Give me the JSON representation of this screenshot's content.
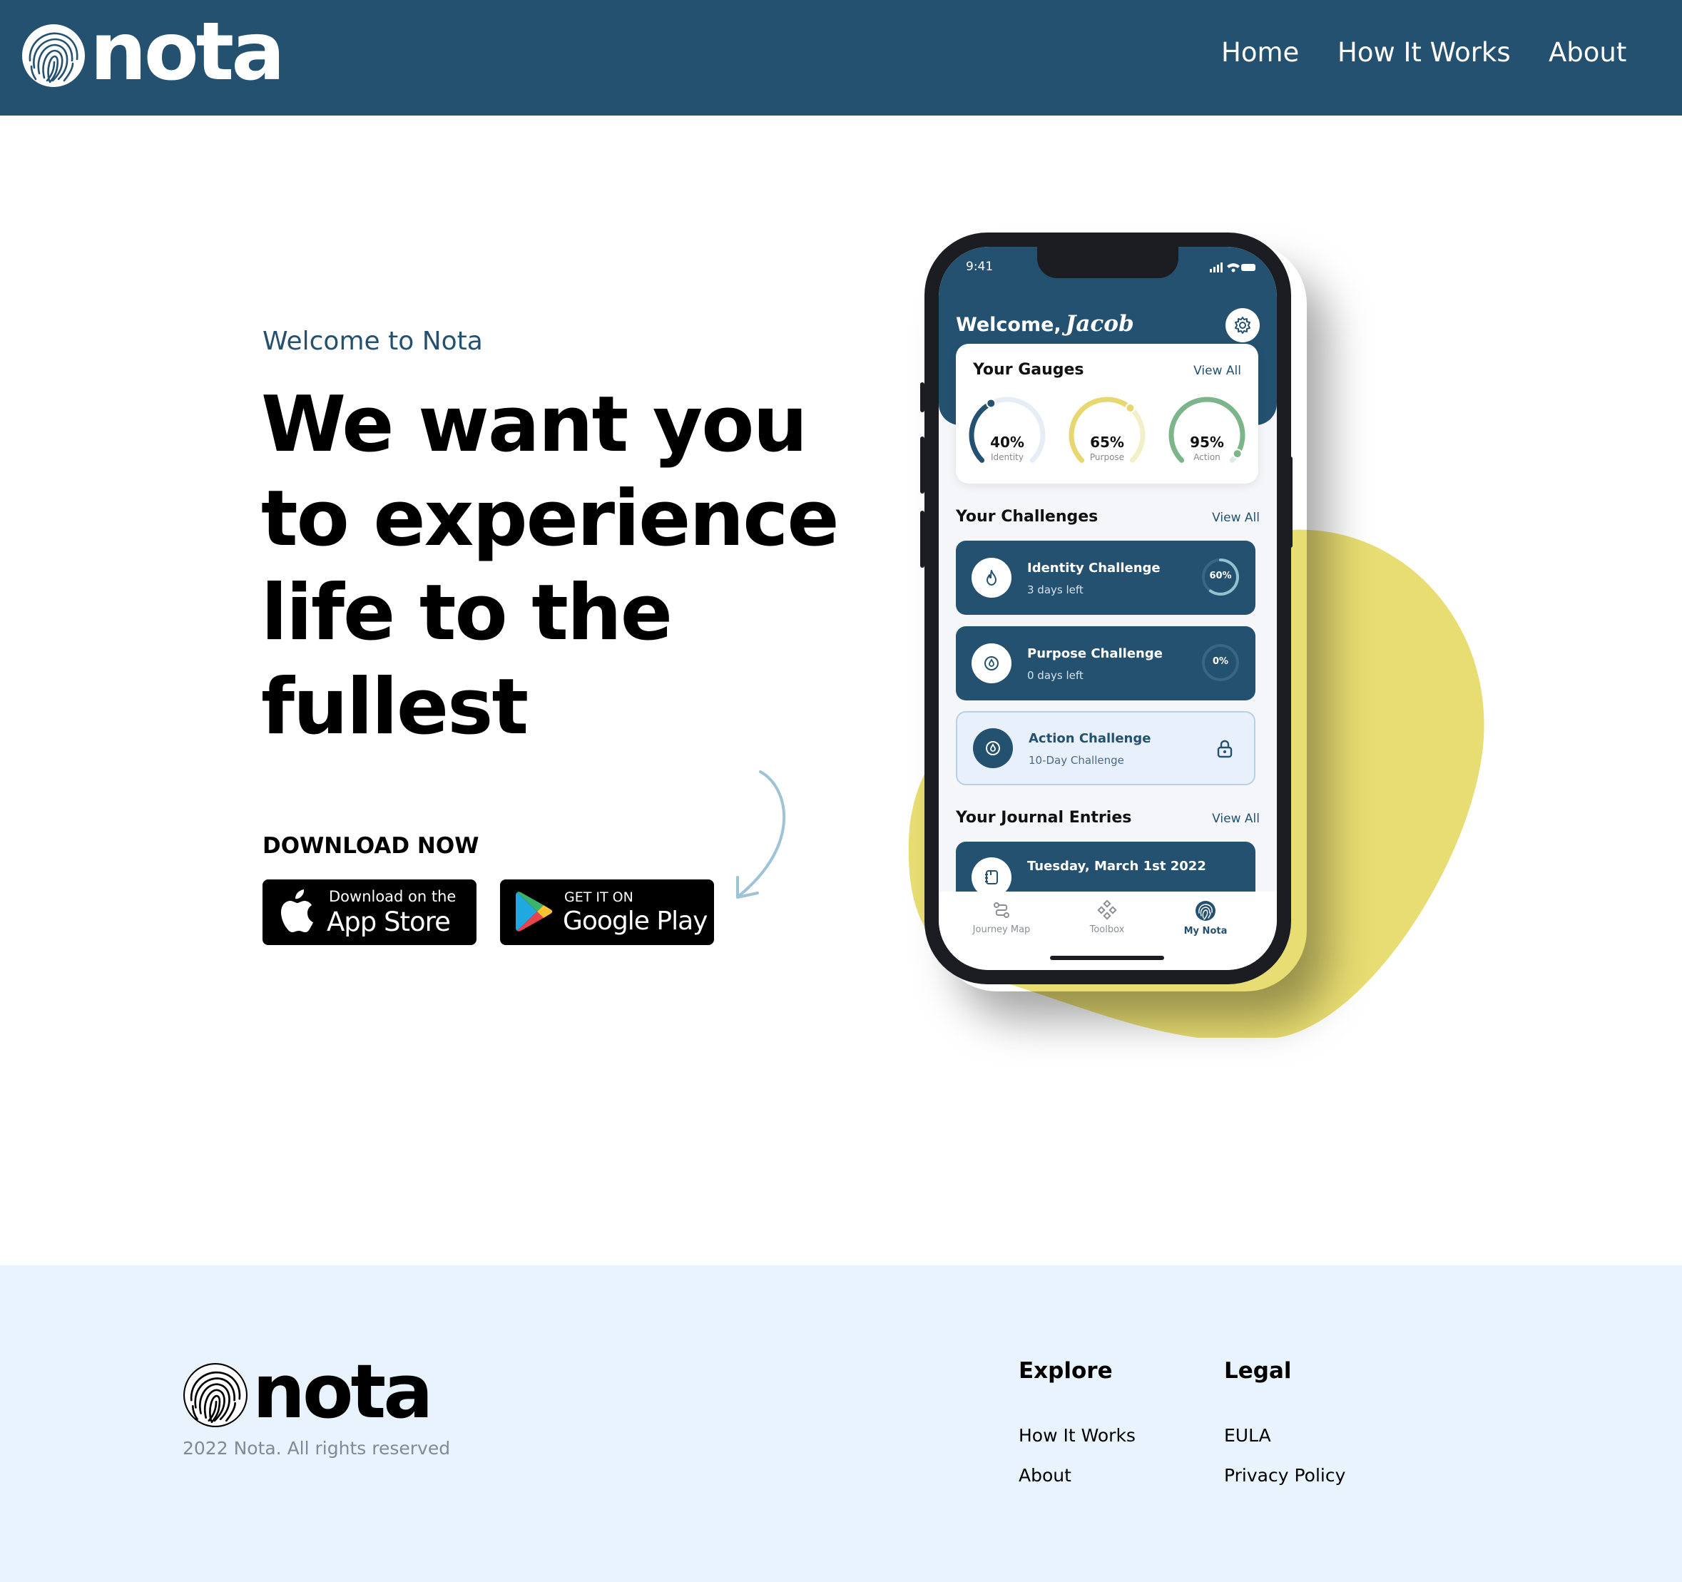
{
  "header": {
    "brand": "nota",
    "nav": [
      {
        "label": "Home"
      },
      {
        "label": "How It Works"
      },
      {
        "label": "About"
      }
    ]
  },
  "hero": {
    "eyebrow": "Welcome to Nota",
    "headline_lines": [
      "We want you",
      "to experience",
      "life to the",
      "fullest"
    ],
    "download_title": "DOWNLOAD NOW",
    "app_store": {
      "small": "Download on the",
      "big": "App Store"
    },
    "google_play": {
      "small": "GET IT ON",
      "big": "Google Play"
    }
  },
  "phone": {
    "status_time": "9:41",
    "welcome": "Welcome,",
    "user_name": "Jacob",
    "gauges": {
      "title": "Your Gauges",
      "view_all": "View All",
      "items": [
        {
          "value": "40%",
          "label": "Identity",
          "level": 0.4,
          "color": "#245170",
          "track": "#e6edf4"
        },
        {
          "value": "65%",
          "label": "Purpose",
          "level": 0.65,
          "color": "#e6d86f",
          "track": "#f3efc9"
        },
        {
          "value": "95%",
          "label": "Action",
          "level": 0.95,
          "color": "#7db58a",
          "track": "#dcebdf"
        }
      ]
    },
    "challenges": {
      "title": "Your Challenges",
      "view_all": "View All",
      "items": [
        {
          "name": "Identity Challenge",
          "sub": "3 days left",
          "progress": "60%",
          "level": 0.6
        },
        {
          "name": "Purpose Challenge",
          "sub": "0 days left",
          "progress": "0%",
          "level": 0
        },
        {
          "name": "Action Challenge",
          "sub": "10-Day Challenge",
          "locked": true
        }
      ]
    },
    "journal": {
      "title": "Your Journal Entries",
      "view_all": "View All",
      "entry": "Tuesday, March 1st 2022"
    },
    "tabs": [
      {
        "label": "Journey Map"
      },
      {
        "label": "Toolbox"
      },
      {
        "label": "My Nota"
      }
    ]
  },
  "footer": {
    "brand": "nota",
    "copyright": "2022 Nota. All rights reserved",
    "explore": {
      "title": "Explore",
      "links": [
        "How It Works",
        "About"
      ]
    },
    "legal": {
      "title": "Legal",
      "links": [
        "EULA",
        "Privacy Policy"
      ]
    }
  },
  "colors": {
    "brand_navy": "#245170",
    "blob_yellow": "#e8dd72",
    "footer_bg": "#e9f3fd"
  }
}
